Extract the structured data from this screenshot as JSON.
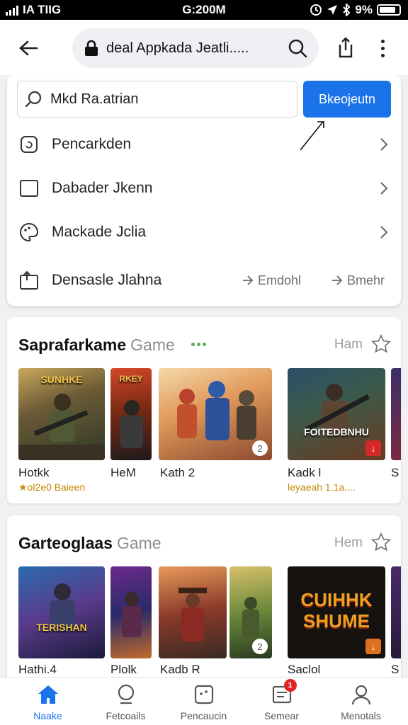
{
  "status_bar": {
    "carrier": "IA TIIG",
    "time": "G:200M",
    "battery": "9%"
  },
  "browser": {
    "url": "deal Appkada Jeatli.....",
    "icons": [
      "back-arrow-icon",
      "lock-icon",
      "search-icon",
      "share-icon",
      "more-vertical-icon"
    ]
  },
  "search": {
    "value": "Mkd Ra.atrian",
    "button_label": "Bkeojeutn"
  },
  "menu": {
    "items": [
      {
        "label": "Pencarkden",
        "icon": "refresh-square-icon"
      },
      {
        "label": "Dabader Jkenn",
        "icon": "square-icon"
      },
      {
        "label": "Mackade Jclia",
        "icon": "palette-icon"
      },
      {
        "label": "Densasle Jlahna",
        "icon": "export-icon"
      }
    ],
    "actions": [
      "Emdohl",
      "Bmehr"
    ]
  },
  "sections": [
    {
      "title": "Saprafarkame",
      "subtitle": "Game",
      "more": "Ham",
      "tiles": [
        {
          "name": "Hotkk",
          "meta": "★ol2e0 Baieen",
          "caption": "SUNHKE"
        },
        {
          "name": "HeM",
          "caption": "RKEY"
        },
        {
          "name": "Kath 2",
          "badge": "2"
        },
        {
          "name": "Kadk l",
          "meta": "leyaeah 1.1a....",
          "caption": "FOITEDBNHU"
        },
        {
          "name": "S"
        }
      ]
    },
    {
      "title": "Garteoglaas",
      "subtitle": "Game",
      "more": "Hem",
      "tiles": [
        {
          "name": "Hathi.4",
          "caption": "TERISHAN"
        },
        {
          "name": "Plolk"
        },
        {
          "name": "Kadb R",
          "badge": "2"
        },
        {
          "name": "Saclol",
          "caption": "CUIHHK SHUME"
        },
        {
          "name": "S"
        }
      ]
    }
  ],
  "bottom_nav": {
    "items": [
      {
        "label": "Naake",
        "icon": "home-icon"
      },
      {
        "label": "Fetcoails",
        "icon": "search-icon"
      },
      {
        "label": "Pencaucin",
        "icon": "game-icon"
      },
      {
        "label": "Semear",
        "icon": "inbox-icon",
        "badge": "1"
      },
      {
        "label": "Menotals",
        "icon": "profile-icon"
      }
    ]
  },
  "colors": {
    "accent": "#1a73e8",
    "badge": "#e02424"
  }
}
